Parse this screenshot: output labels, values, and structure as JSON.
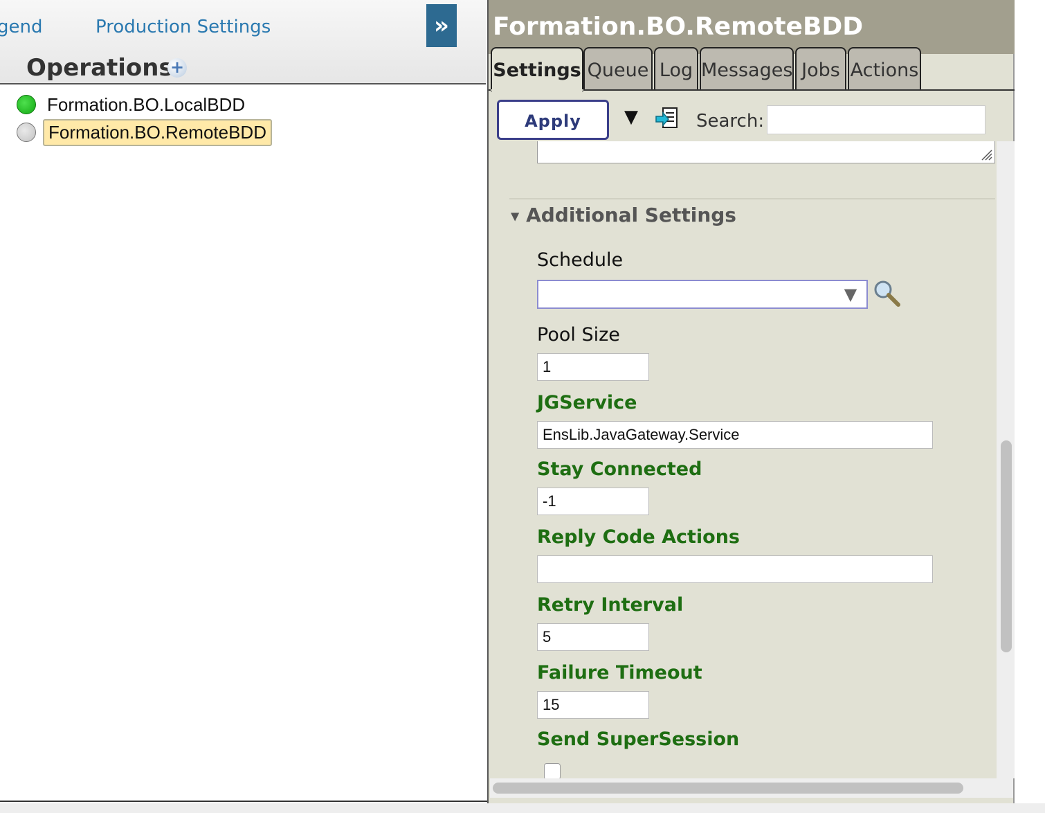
{
  "left": {
    "legend_link": "gend",
    "production_settings_link": "Production Settings",
    "expand_button": "»",
    "operations_title": "Operations",
    "add_icon": "+",
    "operations": [
      {
        "name": "Formation.BO.LocalBDD",
        "status": "green"
      },
      {
        "name": "Formation.BO.RemoteBDD",
        "status": "grey"
      }
    ]
  },
  "panel": {
    "title": "Formation.BO.RemoteBDD",
    "tabs": [
      "Settings",
      "Queue",
      "Log",
      "Messages",
      "Jobs",
      "Actions"
    ],
    "active_tab": "Settings",
    "apply_label": "Apply",
    "dropdown_glyph": "▼",
    "search_label": "Search:",
    "search_value": "",
    "section_title": "Additional Settings",
    "fields": {
      "schedule_label": "Schedule",
      "schedule_value": "",
      "pool_size_label": "Pool Size",
      "pool_size_value": "1",
      "jgservice_label": "JGService",
      "jgservice_value": "EnsLib.JavaGateway.Service",
      "stay_connected_label": "Stay Connected",
      "stay_connected_value": "-1",
      "reply_code_actions_label": "Reply Code Actions",
      "reply_code_actions_value": "",
      "retry_interval_label": "Retry Interval",
      "retry_interval_value": "5",
      "failure_timeout_label": "Failure Timeout",
      "failure_timeout_value": "15",
      "send_supersession_label": "Send SuperSession",
      "send_supersession_checked": false
    }
  },
  "colors": {
    "panel_bg": "#e1e1d4",
    "title_bar": "#a29f8e",
    "setting_label_green": "#1e6e12",
    "link_blue": "#2a79b0",
    "selected_item_bg": "#ffe9a8"
  }
}
